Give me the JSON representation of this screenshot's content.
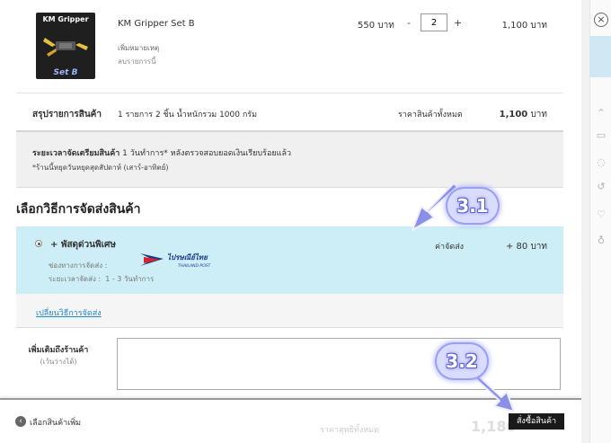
{
  "product": {
    "thumb_title": "KM Gripper",
    "thumb_label": "Set B",
    "name": "KM Gripper Set B",
    "add_note": "เพิ่มหมายเหตุ",
    "remove": "ลบรายการนี้",
    "price": "550 บาท",
    "minus": "-",
    "quantity": "2",
    "plus": "+",
    "line_total": "1,100 บาท"
  },
  "summary": {
    "label": "สรุปรายการสินค้า",
    "detail": "1 รายการ 2 ชิ้น น้ำหนักรวม 1000 กรัม",
    "total_label": "ราคาสินค้าทั้งหมด",
    "total_value": "1,100",
    "total_unit": "บาท"
  },
  "prep": {
    "label": "ระยะเวลาจัดเตรียมสินค้า",
    "text": "1 วันทำการ* หลังตรวจสอบยอดเงินเรียบร้อยแล้ว",
    "note": "*ร้านนี้หยุดวันหยุดสุดสัปดาห์ (เสาร์-อาทิตย์)"
  },
  "shipping": {
    "title": "เลือกวิธีการจัดส่งสินค้า",
    "option_name": "+ พัสดุด่วนพิเศษ",
    "logo_text": "ไปรษณีย์ไทย",
    "logo_sub": "THAILAND POST",
    "channel_label": "ช่องทางการจัดส่ง :",
    "duration_label": "ระยะเวลาจัดส่ง :",
    "duration": "1 - 3 วันทำการ",
    "fee_label": "ค่าจัดส่ง",
    "fee": "+ 80 บาท",
    "change_link": "เปลี่ยนวิธีการจัดส่ง"
  },
  "notes": {
    "label": "เพิ่มเติมถึงร้านค้า",
    "sublabel": "(เว้นว่างได้)"
  },
  "bottom": {
    "back": "เลือกสินค้าเพิ่ม",
    "ghost_label": "ราคาสุทธิทั้งหมด",
    "ghost_value": "1,180",
    "order": "สั่งซื้อสินค้า"
  },
  "annotations": {
    "step1": "3.1",
    "step2": "3.2",
    "badge_color": "#d9dcff",
    "arrow_color": "#8a90e6"
  },
  "colors": {
    "shipping_bg": "#cdeef6",
    "link": "#1e88c8",
    "order_button": "#1a1a1a"
  },
  "close_icon": "×"
}
